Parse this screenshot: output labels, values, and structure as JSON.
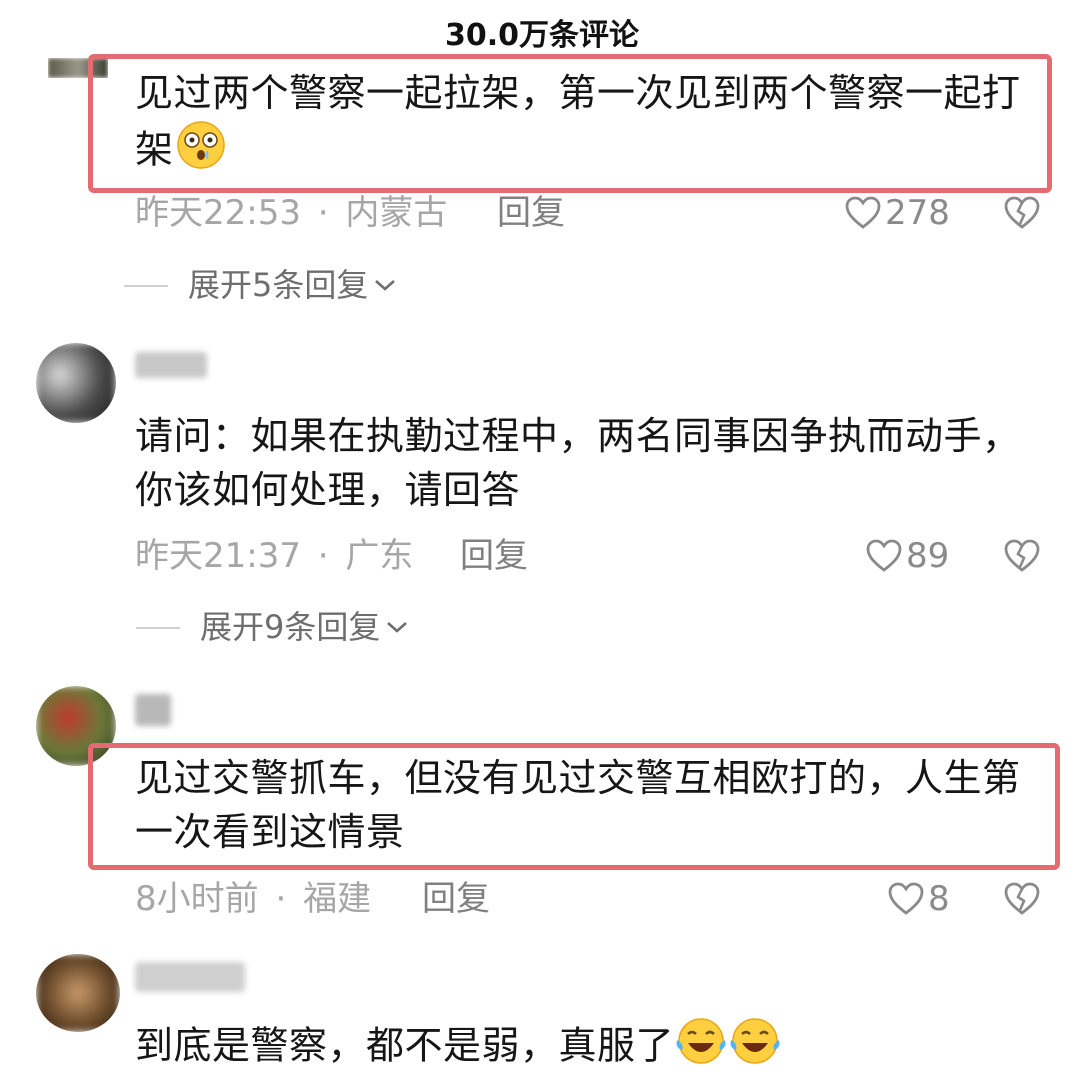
{
  "header": {
    "title": "30.0万条评论"
  },
  "comments": [
    {
      "text": "见过两个警察一起拉架，第一次见到两个警察一起打架",
      "time": "昨天22:53",
      "separator": "·",
      "location": "内蒙古",
      "reply_label": "回复",
      "likes": "278",
      "expand": "展开5条回复",
      "emoji": "flushed-face"
    },
    {
      "text": "请问：如果在执勤过程中，两名同事因争执而动手，你该如何处理，请回答",
      "time": "昨天21:37",
      "separator": "·",
      "location": "广东",
      "reply_label": "回复",
      "likes": "89",
      "expand": "展开9条回复"
    },
    {
      "text": "见过交警抓车，但没有见过交警互相欧打的，人生第一次看到这情景",
      "time": "8小时前",
      "separator": "·",
      "location": "福建",
      "reply_label": "回复",
      "likes": "8"
    },
    {
      "text": "到底是警察，都不是弱，真服了",
      "emoji": "tears-of-joy-face"
    }
  ],
  "colors": {
    "highlight_border": "#e56b73",
    "meta_text": "#a6a6a6",
    "body_text": "#161616"
  }
}
